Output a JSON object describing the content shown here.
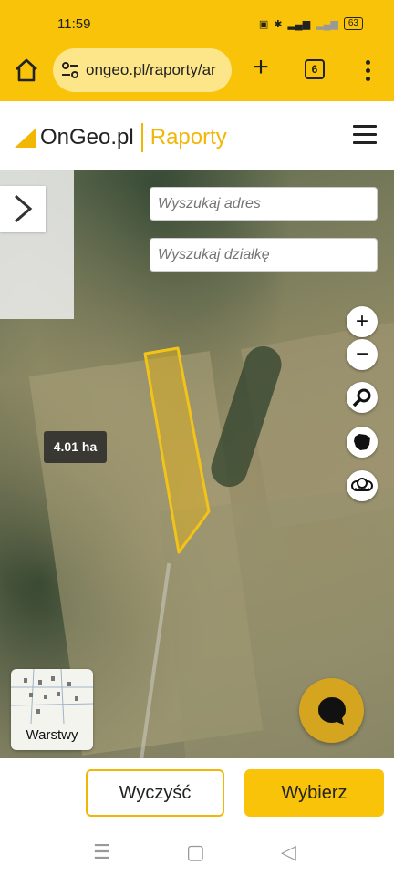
{
  "status": {
    "time": "11:59",
    "battery": "63",
    "icons": [
      "nfc-icon",
      "bluetooth-icon",
      "signal-5g-icon",
      "signal-icon"
    ]
  },
  "browser": {
    "url": "ongeo.pl/raporty/ar",
    "tab_count": "6"
  },
  "header": {
    "brand": "OnGeo.pl",
    "section": "Raporty"
  },
  "map": {
    "search_address_placeholder": "Wyszukaj adres",
    "search_parcel_placeholder": "Wyszukaj działkę",
    "zoom_in": "+",
    "zoom_out": "−",
    "area_label": "4.01 ha",
    "layers_label": "Warstwy",
    "parcel_color": "#f2c318"
  },
  "actions": {
    "clear_label": "Wyczyść",
    "choose_label": "Wybierz"
  },
  "colors": {
    "brand_yellow": "#f8c308",
    "accent": "#f2b705"
  }
}
